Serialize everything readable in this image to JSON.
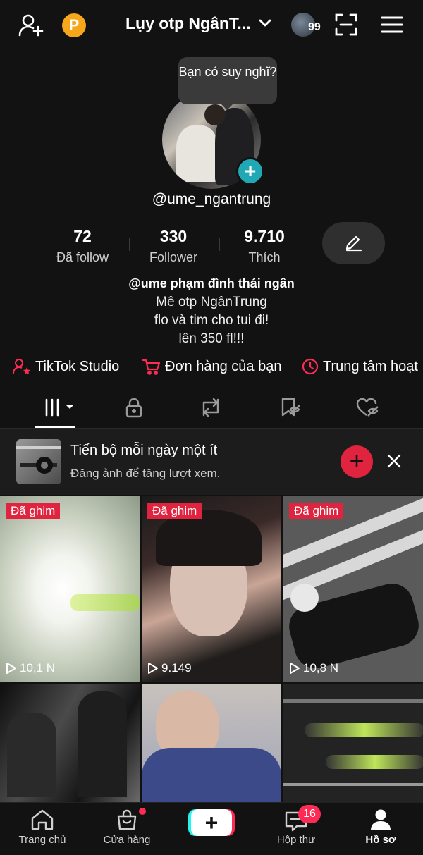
{
  "header": {
    "add_friend_icon": "person-plus-icon",
    "coin_label": "P",
    "title": "Lụy otp NgânT...",
    "avatar_count": "99"
  },
  "tooltip": {
    "text": "Bạn có suy nghĩ?"
  },
  "profile": {
    "username": "@ume_ngantrung",
    "stats": [
      {
        "value": "72",
        "label": "Đã follow"
      },
      {
        "value": "330",
        "label": "Follower"
      },
      {
        "value": "9.710",
        "label": "Thích"
      }
    ],
    "bio_name": "@ume phạm đình thái ngân",
    "bio_lines": [
      "Mê otp NgânTrung",
      "flo và tim cho tui đi!",
      "lên 350 fl!!!"
    ]
  },
  "links": [
    {
      "label": "TikTok Studio",
      "icon": "person-star-icon"
    },
    {
      "label": "Đơn hàng của bạn",
      "icon": "cart-icon"
    },
    {
      "label": "Trung tâm hoạt",
      "icon": "clock-icon"
    }
  ],
  "promo": {
    "title": "Tiến bộ mỗi ngày một ít",
    "subtitle": "Đăng ảnh để tăng lượt xem."
  },
  "videos": [
    {
      "pinned": "Đã ghim",
      "views": "10,1 N"
    },
    {
      "pinned": "Đã ghim",
      "views": "9.149"
    },
    {
      "pinned": "Đã ghim",
      "views": "10,8 N"
    }
  ],
  "nav": {
    "home": "Trang chủ",
    "shop": "Cửa hàng",
    "inbox": "Hộp thư",
    "inbox_badge": "16",
    "profile": "Hồ sơ"
  },
  "colors": {
    "accent": "#fe2c55",
    "pin": "#e0243f",
    "teal": "#20a9b5",
    "coin": "#f6a81a"
  }
}
